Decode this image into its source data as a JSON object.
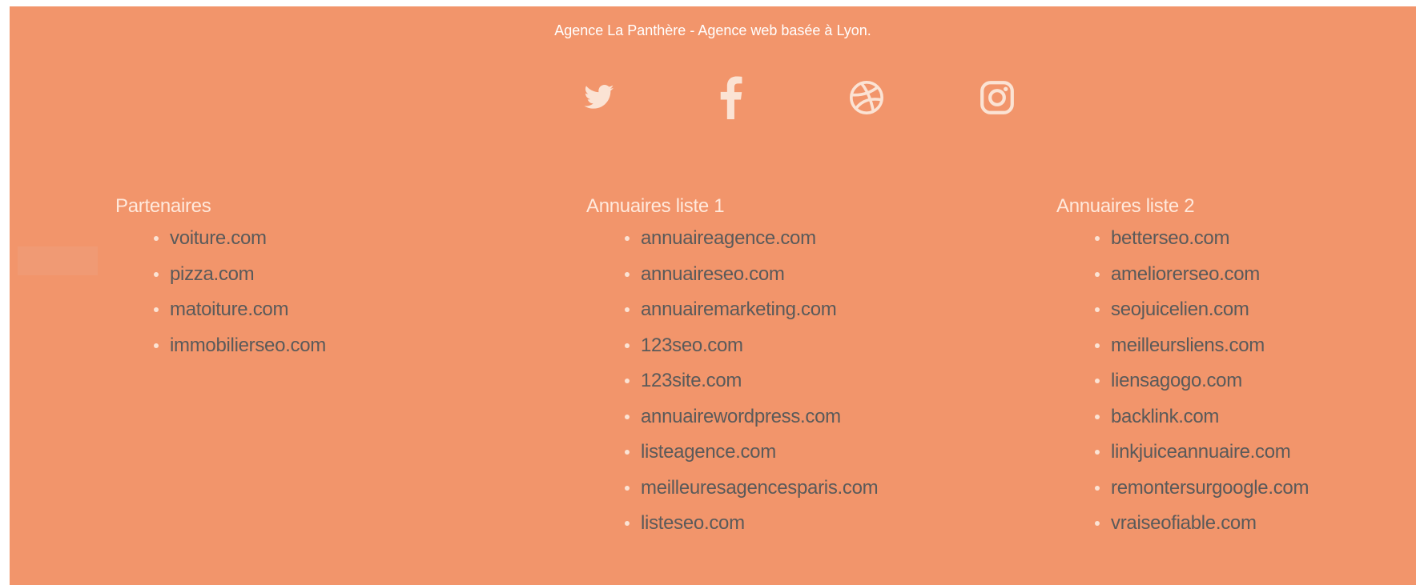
{
  "footer": {
    "tagline": "Agence La Panthère - Agence web basée à Lyon.",
    "socials": [
      {
        "icon": "twitter-icon"
      },
      {
        "icon": "facebook-icon"
      },
      {
        "icon": "dribbble-icon"
      },
      {
        "icon": "instagram-icon"
      }
    ],
    "columns": [
      {
        "title": "Partenaires",
        "links": [
          "voiture.com",
          "pizza.com",
          "matoiture.com",
          "immobilierseo.com"
        ]
      },
      {
        "title": "Annuaires liste 1",
        "links": [
          "annuaireagence.com",
          "annuaireseo.com",
          "annuairemarketing.com",
          "123seo.com",
          "123site.com",
          "annuairewordpress.com",
          "listeagence.com",
          "meilleuresagencesparis.com",
          "listeseo.com"
        ]
      },
      {
        "title": "Annuaires liste 2",
        "links": [
          "betterseo.com",
          "ameliorerseo.com",
          "seojuicelien.com",
          "meilleursliens.com",
          "liensagogo.com",
          "backlink.com",
          "linkjuiceannuaire.com",
          "remontersurgoogle.com",
          "vraiseofiable.com"
        ]
      }
    ]
  },
  "colors": {
    "background": "#f2956b",
    "heading": "#ffe9dc",
    "link": "#5a5a5a",
    "icon": "#fbe3d4"
  }
}
